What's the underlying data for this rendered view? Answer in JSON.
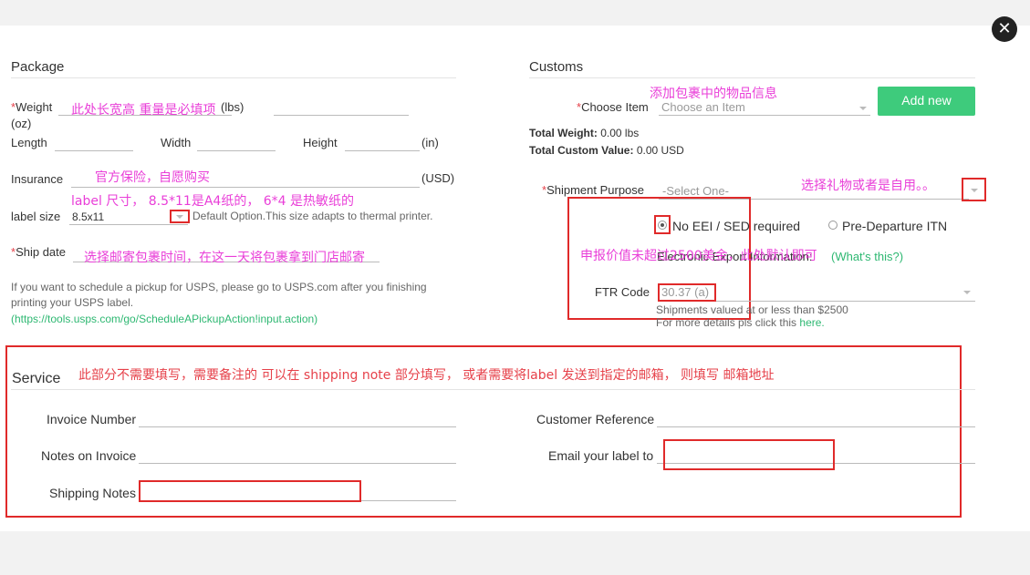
{
  "close_label": "✕",
  "package": {
    "title": "Package",
    "weight_label": "Weight",
    "weight_unit": "(lbs)",
    "weight_unit2": "(oz)",
    "weight_note": "此处长宽高 重量是必填项",
    "length_label": "Length",
    "width_label": "Width",
    "height_label": "Height",
    "dim_unit": "(in)",
    "insurance_label": "Insurance",
    "insurance_note": "官方保险，自愿购买",
    "insurance_unit": "(USD)",
    "label_size_note": "label 尺寸， 8.5*11是A4纸的， 6*4 是热敏纸的",
    "label_size_label": "label size",
    "label_size_value": "8.5x11",
    "label_size_hint": "Default Option.This size adapts to thermal printer.",
    "ship_date_label": "Ship date",
    "ship_date_note": "选择邮寄包裹时间，在这一天将包裹拿到门店邮寄",
    "pickup_info": "If you want to schedule a pickup for USPS, please go to USPS.com after you finishing",
    "pickup_info2": "printing your USPS label.",
    "pickup_url": "(https://tools.usps.com/go/ScheduleAPickupAction!input.action)"
  },
  "customs": {
    "title": "Customs",
    "items_note": "添加包裹中的物品信息",
    "choose_item_label": "Choose Item",
    "choose_item_placeholder": "Choose an Item",
    "add_new_label": "Add new",
    "total_weight_label": "Total Weight:",
    "total_weight_value": "0.00 lbs",
    "total_value_label": "Total Custom Value:",
    "total_value_value": "0.00 USD",
    "purpose_label": "Shipment Purpose",
    "purpose_value": "-Select One-",
    "purpose_note": "选择礼物或者是自用。。",
    "no_eei_label": "No EEI / SED required",
    "pre_departure_label": "Pre-Departure ITN",
    "eei_note": "申报价值未超过2500美金，此处默认即可",
    "eei_info": "Electronic Export Information:",
    "whats_this": "(What's this?)",
    "ftr_label": "FTR Code",
    "ftr_value": "30.37 (a)",
    "ftr_hint1": "Shipments valued at or less than $2500",
    "ftr_hint2": "For more details pls click this",
    "ftr_link": "here."
  },
  "service": {
    "title": "Service",
    "note": "此部分不需要填写，需要备注的 可以在 shipping note 部分填写， 或者需要将label 发送到指定的邮箱， 则填写 邮箱地址",
    "invoice_number_label": "Invoice Number",
    "notes_invoice_label": "Notes on Invoice",
    "shipping_notes_label": "Shipping Notes",
    "customer_ref_label": "Customer Reference",
    "email_label": "Email your label to"
  }
}
